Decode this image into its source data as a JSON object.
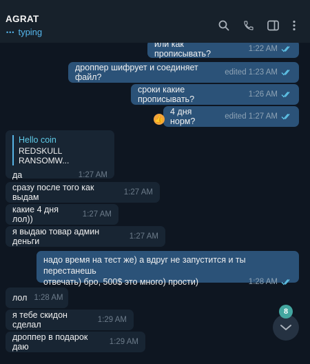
{
  "header": {
    "title": "AGRAT",
    "status": "typing",
    "icons": [
      "search-icon",
      "phone-icon",
      "sidebar-toggle-icon",
      "more-vertical-icon"
    ]
  },
  "messages": [
    {
      "id": "m1",
      "dir": "out",
      "text": "или как прописывать?",
      "time": "1:22 AM",
      "read": true
    },
    {
      "id": "m2",
      "dir": "out",
      "text": "дроппер шифрует и соединяет файл?",
      "time": "edited 1:23 AM",
      "read": true
    },
    {
      "id": "m3",
      "dir": "out",
      "text": "сроки какие прописывать?",
      "time": "1:26 AM",
      "read": true
    },
    {
      "id": "m4",
      "dir": "out",
      "text": "4 дня норм?",
      "time": "edited 1:27 AM",
      "read": true,
      "reaction": "thumbs-up"
    },
    {
      "id": "m5",
      "dir": "in",
      "quote_title": "Hello coin",
      "quote_text": "REDSKULL RANSOMW...",
      "text": "да",
      "time": "1:27 AM"
    },
    {
      "id": "m6",
      "dir": "in",
      "text": "сразу после того как выдам",
      "time": "1:27 AM"
    },
    {
      "id": "m7",
      "dir": "in",
      "text": "какие 4 дня лол))",
      "time": "1:27 AM"
    },
    {
      "id": "m8",
      "dir": "in",
      "text": "я выдаю товар админ деньги",
      "time": "1:27 AM"
    },
    {
      "id": "m9",
      "dir": "out",
      "line1": "надо время на тест же) а вдруг не запустится и ты перестанешь",
      "line2": "отвечать) бро, 500$ это много) прости)",
      "time": "1:28 AM",
      "read": true
    },
    {
      "id": "m10",
      "dir": "in",
      "text": "лол",
      "time": "1:28 AM"
    },
    {
      "id": "m11",
      "dir": "in",
      "text": "я тебе скидон сделал",
      "time": "1:29 AM"
    },
    {
      "id": "m12",
      "dir": "in",
      "text": "дроппер в подарок даю",
      "time": "1:29 AM"
    }
  ],
  "scroll_button": {
    "unread_count": "8"
  },
  "colors": {
    "background": "#0e1621",
    "header": "#17212b",
    "outgoing_bubble": "#2b5278",
    "incoming_bubble": "#182533",
    "accent": "#56b7ee",
    "badge": "#43a6a0"
  }
}
